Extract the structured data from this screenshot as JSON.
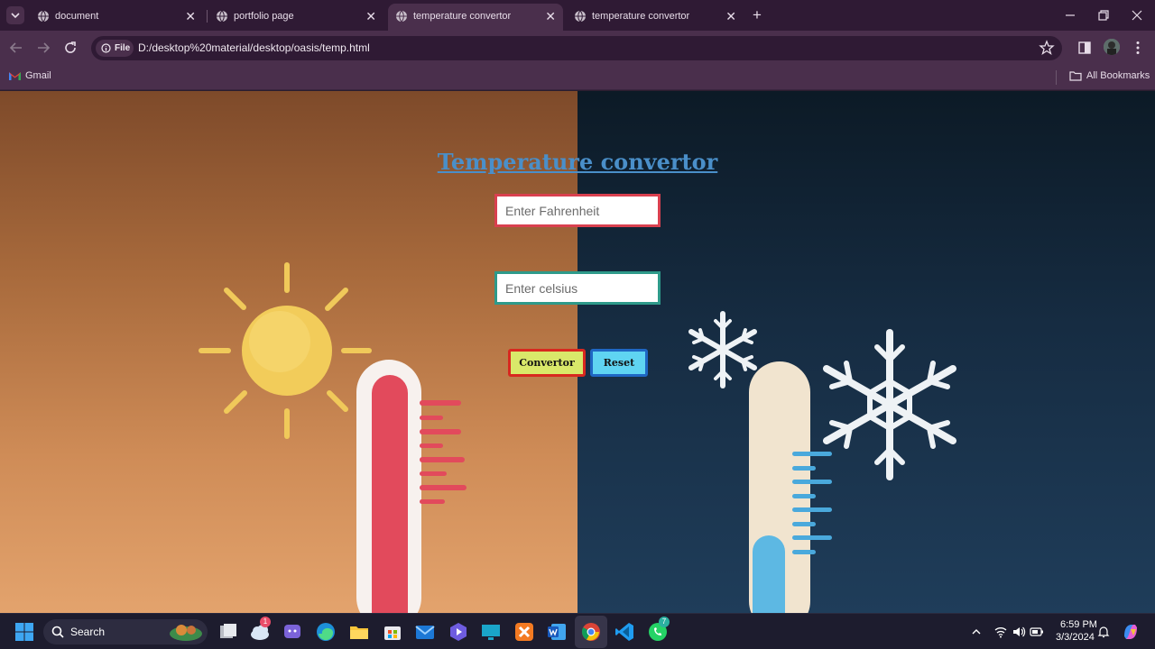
{
  "tabs": [
    {
      "title": "document",
      "active": false
    },
    {
      "title": "portfolio page",
      "active": false
    },
    {
      "title": "temperature convertor",
      "active": true
    },
    {
      "title": "temperature convertor",
      "active": false
    }
  ],
  "toolbar": {
    "file_chip": "File",
    "url": "D:/desktop%20material/desktop/oasis/temp.html"
  },
  "bookmarks": {
    "gmail": "Gmail",
    "all": "All Bookmarks"
  },
  "page": {
    "heading": "Temperature convertor",
    "fahrenheit_placeholder": "Enter Fahrenheit",
    "celsius_placeholder": "Enter celsius",
    "convert_label": "Convertor",
    "reset_label": "Reset"
  },
  "taskbar": {
    "search_label": "Search",
    "time": "6:59 PM",
    "date": "3/3/2024",
    "badge_weather": "1",
    "badge_whatsapp": "7"
  },
  "colors": {
    "tab_strip": "#2f1a34",
    "toolbar": "#4a2f4c",
    "heading": "#4a8fc9",
    "fahrenheit_border": "#d9404f",
    "celsius_border": "#2e9a8a",
    "convert_bg": "#d9e86a",
    "convert_border": "#d8281f",
    "reset_bg": "#5fd4f2",
    "reset_border": "#1f67c4"
  }
}
